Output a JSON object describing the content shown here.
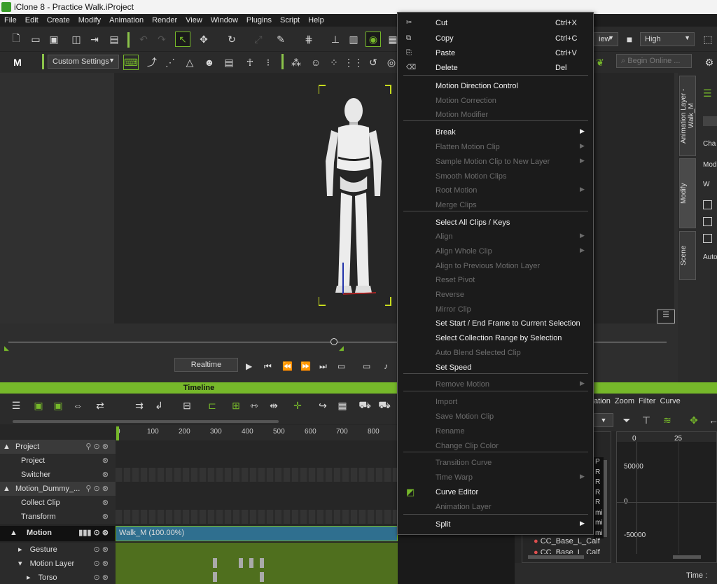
{
  "window": {
    "title": "iClone 8 - Practice Walk.iProject"
  },
  "menubar": {
    "items": [
      "File",
      "Edit",
      "Create",
      "Modify",
      "Animation",
      "Render",
      "View",
      "Window",
      "Plugins",
      "Script",
      "Help"
    ]
  },
  "toolbar": {
    "preset": "Custom Settings",
    "view_label": "iew",
    "quality": "High",
    "search_placeholder": "Begin Online ..."
  },
  "right_tabs": [
    "Animation Layer - Walk_M",
    "Modify",
    "Scene"
  ],
  "right_panel": {
    "labels": [
      "Cha",
      "Mod",
      "W",
      "Auto"
    ]
  },
  "playback": {
    "mode": "Realtime"
  },
  "timeline": {
    "title": "Timeline",
    "ruler": [
      "0",
      "100",
      "200",
      "300",
      "400",
      "500",
      "600",
      "700",
      "800"
    ],
    "tracks": [
      {
        "label": "Project",
        "level": 0
      },
      {
        "label": "Project",
        "level": 1
      },
      {
        "label": "Switcher",
        "level": 1
      },
      {
        "label": "Motion_Dummy_...",
        "level": 0
      },
      {
        "label": "Collect Clip",
        "level": 1
      },
      {
        "label": "Transform",
        "level": 1
      },
      {
        "label": "Motion",
        "level": 0
      },
      {
        "label": "Gesture",
        "level": 1
      },
      {
        "label": "Motion Layer",
        "level": 1
      },
      {
        "label": "Torso",
        "level": 2
      }
    ],
    "clip_label": "Walk_M (100.00%)"
  },
  "curve_editor": {
    "menu": [
      "ation",
      "Zoom",
      "Filter",
      "Curve"
    ],
    "axis_x": [
      "0",
      "25"
    ],
    "axis_y": [
      "50000",
      "0",
      "-50000"
    ],
    "list_codes": [
      "P",
      "R",
      "R",
      "R",
      "R",
      "mi",
      "mi",
      "mi"
    ],
    "list_item": "CC_Base_L_Calf",
    "list_item_partial": "CC_Base_L_Calf",
    "time_label": "Time :"
  },
  "context_menu": {
    "items": [
      {
        "label": "Cut",
        "shortcut": "Ctrl+X",
        "enabled": true,
        "icon": "cut-icon"
      },
      {
        "label": "Copy",
        "shortcut": "Ctrl+C",
        "enabled": true,
        "icon": "copy-icon"
      },
      {
        "label": "Paste",
        "shortcut": "Ctrl+V",
        "enabled": true,
        "icon": "paste-icon"
      },
      {
        "label": "Delete",
        "shortcut": "Del",
        "enabled": true,
        "icon": "delete-icon"
      },
      {
        "label": "Motion Direction Control",
        "enabled": true
      },
      {
        "label": "Motion Correction",
        "enabled": false
      },
      {
        "label": "Motion Modifier",
        "enabled": false
      },
      {
        "label": "Break",
        "enabled": true,
        "submenu": true
      },
      {
        "label": "Flatten Motion Clip",
        "enabled": false,
        "submenu": true
      },
      {
        "label": "Sample Motion Clip to New Layer",
        "enabled": false,
        "submenu": true
      },
      {
        "label": "Smooth Motion Clips",
        "enabled": false
      },
      {
        "label": "Root Motion",
        "enabled": false,
        "submenu": true
      },
      {
        "label": "Merge Clips",
        "enabled": false
      },
      {
        "label": "Select All Clips / Keys",
        "enabled": true
      },
      {
        "label": "Align",
        "enabled": false,
        "submenu": true
      },
      {
        "label": "Align Whole Clip",
        "enabled": false,
        "submenu": true
      },
      {
        "label": "Align to Previous Motion Layer",
        "enabled": false
      },
      {
        "label": "Reset Pivot",
        "enabled": false
      },
      {
        "label": "Reverse",
        "enabled": false
      },
      {
        "label": "Mirror Clip",
        "enabled": false
      },
      {
        "label": "Set Start / End Frame to Current Selection",
        "enabled": true
      },
      {
        "label": "Select Collection Range by Selection",
        "enabled": true
      },
      {
        "label": "Auto Blend Selected Clip",
        "enabled": false
      },
      {
        "label": "Set Speed",
        "enabled": true
      },
      {
        "label": "Remove Motion",
        "enabled": false,
        "submenu": true
      },
      {
        "label": "Import",
        "enabled": false
      },
      {
        "label": "Save Motion Clip",
        "enabled": false
      },
      {
        "label": "Rename",
        "enabled": false
      },
      {
        "label": "Change Clip Color",
        "enabled": false
      },
      {
        "label": "Transition Curve",
        "enabled": false
      },
      {
        "label": "Time Warp",
        "enabled": false,
        "submenu": true
      },
      {
        "label": "Curve Editor",
        "enabled": true,
        "icon": "curve-editor-icon"
      },
      {
        "label": "Animation Layer",
        "enabled": false
      },
      {
        "label": "Split",
        "enabled": true,
        "submenu": true
      }
    ]
  },
  "colors": {
    "accent": "#76b82a",
    "clip": "#2f6f8f",
    "track_green": "#4f6f1e"
  }
}
